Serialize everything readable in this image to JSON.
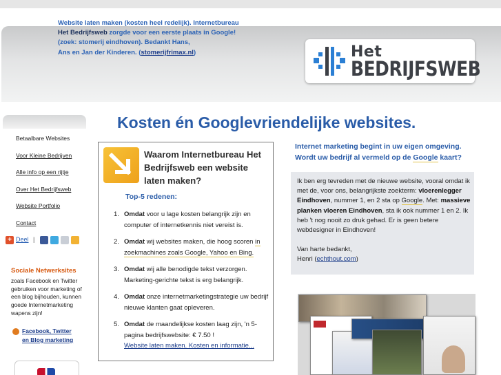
{
  "header": {
    "line1": "Website laten maken (kosten heel redelijk). Internetbureau",
    "line2_strong": "Het Bedrijfsweb",
    "line2_rest": " zorgde voor een eerste plaats in Google!",
    "line3": "(zoek: stomerij eindhoven).  Bedankt Hans,",
    "line4": "Ans en Jan der Kinderen.  (",
    "line4_link": "stomerijfrimax.nl",
    "line4_end": ")"
  },
  "logo": {
    "line1": "Het",
    "line2": "BEDRIJFSWEB"
  },
  "nav": {
    "items": [
      {
        "label": "Betaalbare Websites"
      },
      {
        "label": "Voor Kleine Bedrijven"
      },
      {
        "label": "Alle info op een rijtje"
      },
      {
        "label": "Over Het Bedrijfsweb"
      },
      {
        "label": "Website Portfolio"
      },
      {
        "label": "Contact"
      }
    ]
  },
  "share": {
    "label": "Deel",
    "separator": "|"
  },
  "social": {
    "title": "Sociale Netwerksites",
    "text": "zoals Facebook en Twitter gebruiken voor marketing of een blog bijhouden, kunnen goede Internetmarketing wapens zijn!",
    "link_line1": "Facebook, Twitter",
    "link_line2": "en Blog marketing"
  },
  "main": {
    "title": "Kosten én Googlevriendelijke websites."
  },
  "why": {
    "title": "Waarom Internetbureau Het Bedrijfsweb een website laten maken?",
    "top5": "Top-5  redenen:",
    "reasons": [
      {
        "num": "1.",
        "bold": "Omdat",
        "text": " voor u lage kosten belangrijk zijn en computer of internetkennis niet vereist is."
      },
      {
        "num": "2.",
        "bold": "Omdat",
        "text": " wij websites maken, die hoog scoren ",
        "hl": "in zoekmachines zoals Google, Yahoo en Bing."
      },
      {
        "num": "3.",
        "bold": "Omdat",
        "text": " wij alle benodigde tekst verzorgen. Marketing-gerichte tekst is erg belangrijk."
      },
      {
        "num": "4.",
        "bold": "Omdat",
        "text": " onze internetmarketingstrategie uw bedrijf nieuwe klanten gaat opleveren."
      },
      {
        "num": "5.",
        "bold": "Omdat",
        "text": " de maandelijkse kosten laag zijn, 'n 5-pagina bedrijfswebsite: € 7.50 !",
        "link": "Website laten maken. Kosten en informatie..."
      }
    ]
  },
  "right": {
    "title_line1": "Internet marketing begint in uw eigen omgeving.",
    "title_line2_pre": "Wordt uw bedrijf al vermeld op de ",
    "title_line2_hl": "Google",
    "title_line2_post": " kaart?",
    "quote_p1": "Ik ben erg tevreden met de nieuwe website, vooral omdat ik met de, voor ons, belangrijkste zoekterm:",
    "quote_bold1": "vloerenlegger Eindhoven",
    "quote_p2": ", nummer 1, en 2 sta op",
    "quote_hl1": "Google",
    "quote_p3": ". Met: ",
    "quote_bold2": "massieve planken vloeren Eindhoven",
    "quote_p4": ", sta ik ook nummer 1 en 2. Ik heb 't nog nooit zo druk gehad. Er is geen betere webdesigner in Eindhoven!",
    "sign1": "Van harte bedankt,",
    "sign2_pre": "Henri  (",
    "sign2_link": "echthout.com",
    "sign2_end": ")"
  },
  "colors": {
    "accent_blue": "#2a5ca8",
    "orange": "#d7590f",
    "header_gray": "#d9dadb"
  }
}
